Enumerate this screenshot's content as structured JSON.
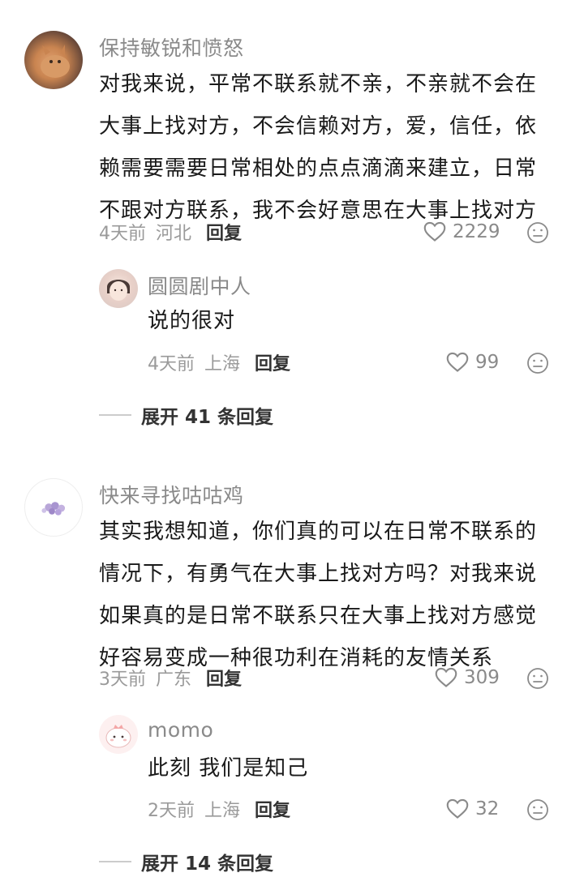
{
  "comments": [
    {
      "username": "保持敏锐和愤怒",
      "lines": [
        "对我来说，平常不联系就不亲，不亲就不会在",
        "大事上找对方，不会信赖对方，爱，信任，依",
        "赖需要需要日常相处的点点滴滴来建立，日常",
        "不跟对方联系，我不会好意思在大事上找对方"
      ],
      "time": "4天前",
      "location": "河北",
      "reply_label": "回复",
      "likes": "2229",
      "reply": {
        "username": "圆圆剧中人",
        "text": "说的很对",
        "time": "4天前",
        "location": "上海",
        "reply_label": "回复",
        "likes": "99"
      },
      "expand_label": "展开 41 条回复"
    },
    {
      "username": "快来寻找咕咕鸡",
      "lines": [
        "其实我想知道，你们真的可以在日常不联系的",
        "情况下，有勇气在大事上找对方吗？对我来说",
        "如果真的是日常不联系只在大事上找对方感觉",
        "好容易变成一种很功利在消耗的友情关系"
      ],
      "time": "3天前",
      "location": "广东",
      "reply_label": "回复",
      "likes": "309",
      "reply": {
        "username": "momo",
        "text": "此刻 我们是知己",
        "time": "2天前",
        "location": "上海",
        "reply_label": "回复",
        "likes": "32"
      },
      "expand_label": "展开 14 条回复"
    }
  ],
  "colors": {
    "name": "#8a8a8a",
    "meta": "#9a9a9a",
    "text": "#1a1a1a",
    "icon": "#8a8a8a"
  },
  "icons": {
    "like": "heart-outline-icon",
    "dislike": "meh-face-icon"
  }
}
